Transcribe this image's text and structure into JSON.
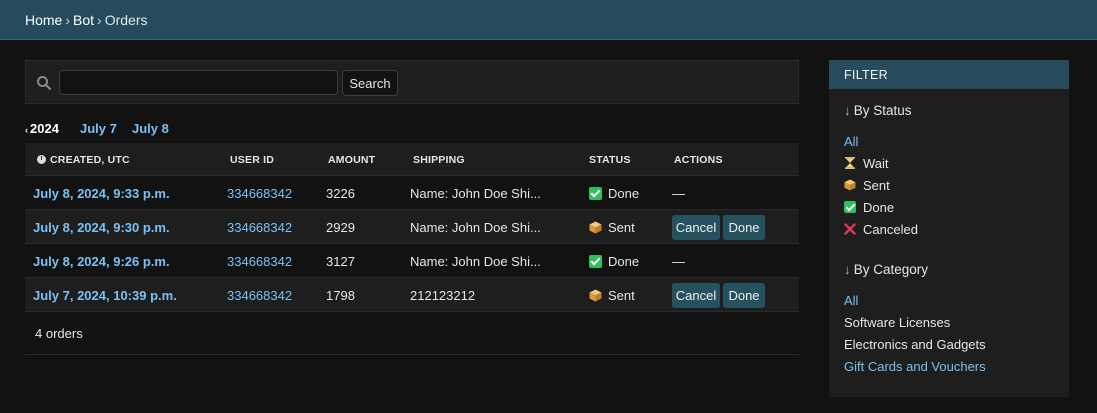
{
  "breadcrumb": {
    "home": "Home",
    "bot": "Bot",
    "current": "Orders",
    "sep": "›"
  },
  "search": {
    "value": "",
    "placeholder": "",
    "button": "Search"
  },
  "date_nav": {
    "year_arrow": "‹",
    "year": "2024",
    "links": [
      "July 7",
      "July 8"
    ]
  },
  "table": {
    "columns": {
      "created": "CREATED, UTC",
      "user": "USER ID",
      "amount": "AMOUNT",
      "shipping": "SHIPPING",
      "status": "STATUS",
      "actions": "ACTIONS"
    },
    "rows": [
      {
        "created": "July 8, 2024, 9:33 p.m.",
        "user": "334668342",
        "amount": "3226",
        "shipping": "Name: John Doe Shi...",
        "status": "Done",
        "actions": "—"
      },
      {
        "created": "July 8, 2024, 9:30 p.m.",
        "user": "334668342",
        "amount": "2929",
        "shipping": "Name: John Doe Shi...",
        "status": "Sent",
        "cancel": "Cancel",
        "done": "Done"
      },
      {
        "created": "July 8, 2024, 9:26 p.m.",
        "user": "334668342",
        "amount": "3127",
        "shipping": "Name: John Doe Shi...",
        "status": "Done",
        "actions": "—"
      },
      {
        "created": "July 7, 2024, 10:39 p.m.",
        "user": "334668342",
        "amount": "1798",
        "shipping": "212123212",
        "status": "Sent",
        "cancel": "Cancel",
        "done": "Done"
      }
    ],
    "count": "4 orders"
  },
  "filter": {
    "title": "FILTER",
    "arrow": "↓",
    "status_title": "By Status",
    "status_items": [
      "All",
      "Wait",
      "Sent",
      "Done",
      "Canceled"
    ],
    "category_title": "By Category",
    "category_items": [
      "All",
      "Software Licenses",
      "Electronics and Gadgets",
      "Gift Cards and Vouchers"
    ]
  },
  "colors": {
    "accent": "#79c1f5",
    "header": "#264b5d",
    "done": "#2fbf5c",
    "canceled": "#e0365a"
  }
}
